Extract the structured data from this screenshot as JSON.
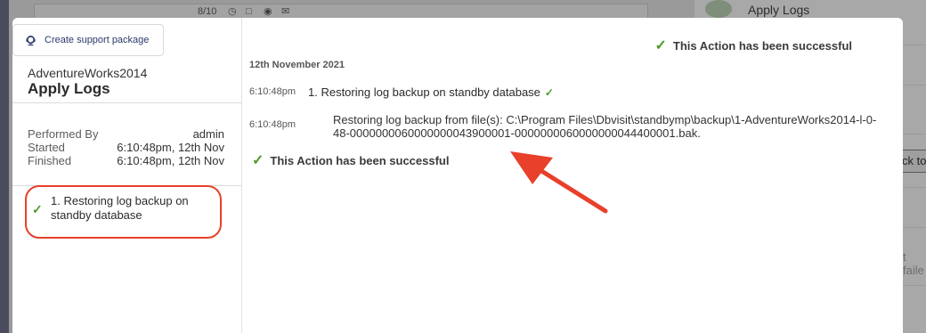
{
  "background": {
    "counter": "8/10",
    "apply_logs_label": "Apply Logs",
    "button_fragment": "ck to",
    "failed_fragment": "t faile"
  },
  "modal": {
    "support_button_label": "Create support package",
    "database_name": "AdventureWorks2014",
    "task_title": "Apply Logs",
    "meta": {
      "performed_by_label": "Performed By",
      "performed_by_value": "admin",
      "started_label": "Started",
      "started_value": "6:10:48pm, 12th Nov",
      "finished_label": "Finished",
      "finished_value": "6:10:48pm, 12th Nov"
    },
    "steps": [
      {
        "label": "1. Restoring log backup on standby database",
        "status": "success"
      }
    ],
    "log": {
      "top_status": "This Action has been successful",
      "date": "12th November 2021",
      "entries": [
        {
          "time": "6:10:48pm",
          "text": "1. Restoring log backup on standby database"
        },
        {
          "time": "6:10:48pm",
          "text": "Restoring log backup from file(s): C:\\Program Files\\Dbvisit\\standbymp\\backup\\1-AdventureWorks2014-l-0-48-0000000060000000043900001-0000000060000000044400001.bak."
        }
      ],
      "bottom_status": "This Action has been successful"
    }
  },
  "colors": {
    "success_green": "#4f9a2a",
    "annotation_red": "#e8402a",
    "accent_navy": "#2a3a6a"
  }
}
